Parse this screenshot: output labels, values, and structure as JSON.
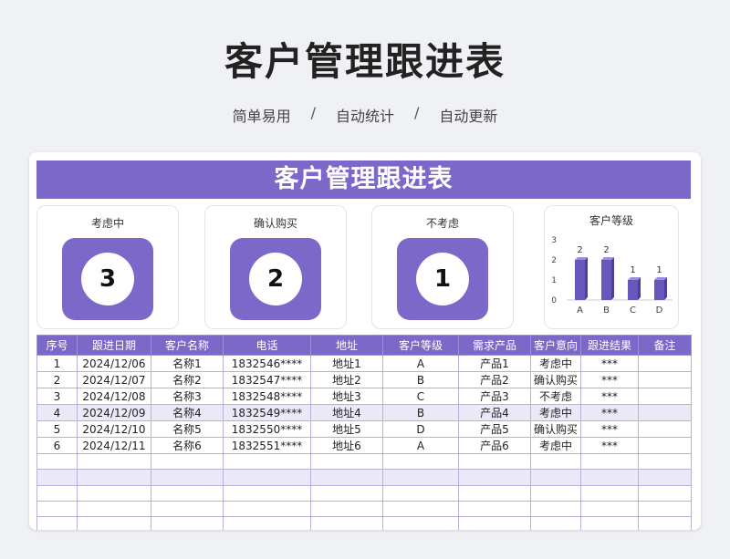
{
  "page": {
    "title": "客户管理跟进表",
    "subtitle": [
      "简单易用",
      "自动统计",
      "自动更新"
    ],
    "separator": "/"
  },
  "sheet": {
    "header": "客户管理跟进表"
  },
  "cards": [
    {
      "label": "考虑中",
      "value": "3"
    },
    {
      "label": "确认购买",
      "value": "2"
    },
    {
      "label": "不考虑",
      "value": "1"
    }
  ],
  "colors": {
    "accent": "#7b68c8",
    "row_alt": "#ebe8f7"
  },
  "chart_data": {
    "type": "bar",
    "title": "客户等级",
    "categories": [
      "A",
      "B",
      "C",
      "D"
    ],
    "values": [
      2,
      2,
      1,
      1
    ],
    "ylim": [
      0,
      3
    ],
    "yticks": [
      0,
      1,
      2,
      3
    ],
    "grid": false
  },
  "table": {
    "columns": [
      "序号",
      "跟进日期",
      "客户名称",
      "电话",
      "地址",
      "客户等级",
      "需求产品",
      "客户意向",
      "跟进结果",
      "备注"
    ],
    "rows": [
      [
        "1",
        "2024/12/06",
        "名称1",
        "1832546****",
        "地址1",
        "A",
        "产品1",
        "考虑中",
        "***",
        ""
      ],
      [
        "2",
        "2024/12/07",
        "名称2",
        "1832547****",
        "地址2",
        "B",
        "产品2",
        "确认购买",
        "***",
        ""
      ],
      [
        "3",
        "2024/12/08",
        "名称3",
        "1832548****",
        "地址3",
        "C",
        "产品3",
        "不考虑",
        "***",
        ""
      ],
      [
        "4",
        "2024/12/09",
        "名称4",
        "1832549****",
        "地址4",
        "B",
        "产品4",
        "考虑中",
        "***",
        ""
      ],
      [
        "5",
        "2024/12/10",
        "名称5",
        "1832550****",
        "地址5",
        "D",
        "产品5",
        "确认购买",
        "***",
        ""
      ],
      [
        "6",
        "2024/12/11",
        "名称6",
        "1832551****",
        "地址6",
        "A",
        "产品6",
        "考虑中",
        "***",
        ""
      ],
      [
        "",
        "",
        "",
        "",
        "",
        "",
        "",
        "",
        "",
        ""
      ],
      [
        "",
        "",
        "",
        "",
        "",
        "",
        "",
        "",
        "",
        ""
      ],
      [
        "",
        "",
        "",
        "",
        "",
        "",
        "",
        "",
        "",
        ""
      ],
      [
        "",
        "",
        "",
        "",
        "",
        "",
        "",
        "",
        "",
        ""
      ],
      [
        "",
        "",
        "",
        "",
        "",
        "",
        "",
        "",
        "",
        ""
      ]
    ]
  }
}
